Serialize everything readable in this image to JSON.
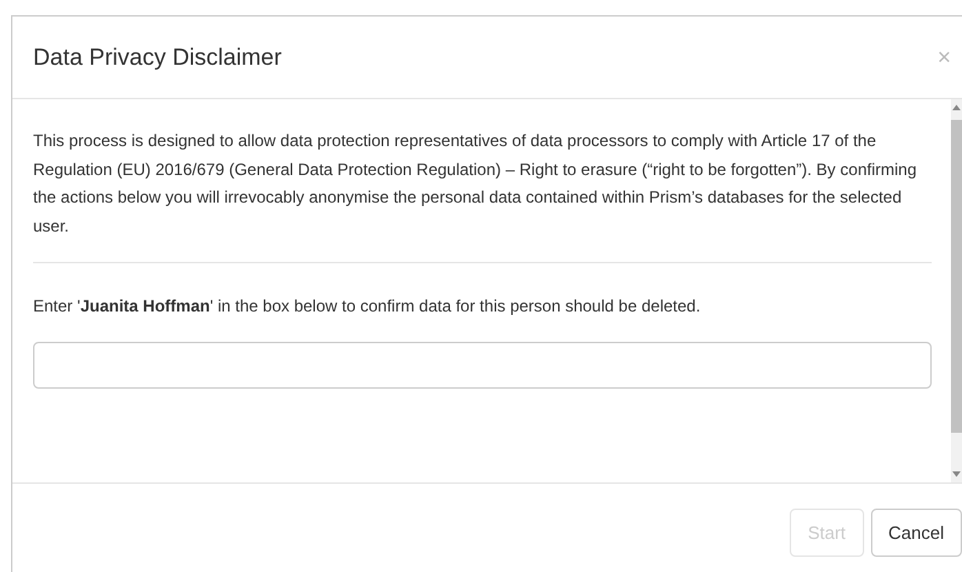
{
  "dialog": {
    "title": "Data Privacy Disclaimer",
    "close": "×",
    "description": "This process is designed to allow data protection representatives of data processors to comply with Article 17 of the Regulation (EU) 2016/679 (General Data Protection Regulation) – Right to erasure (“right to be forgotten”). By confirming the actions below you will irrevocably anonymise the personal data contained within Prism’s databases for the selected user.",
    "prompt": "Enter '**Juanita Hoffman**' in the box below to confirm data for this person should be deleted.",
    "buttons": [
      {
        "label": "Start",
        "disabled": true
      },
      {
        "label": "Cancel",
        "disabled": false
      }
    ]
  }
}
